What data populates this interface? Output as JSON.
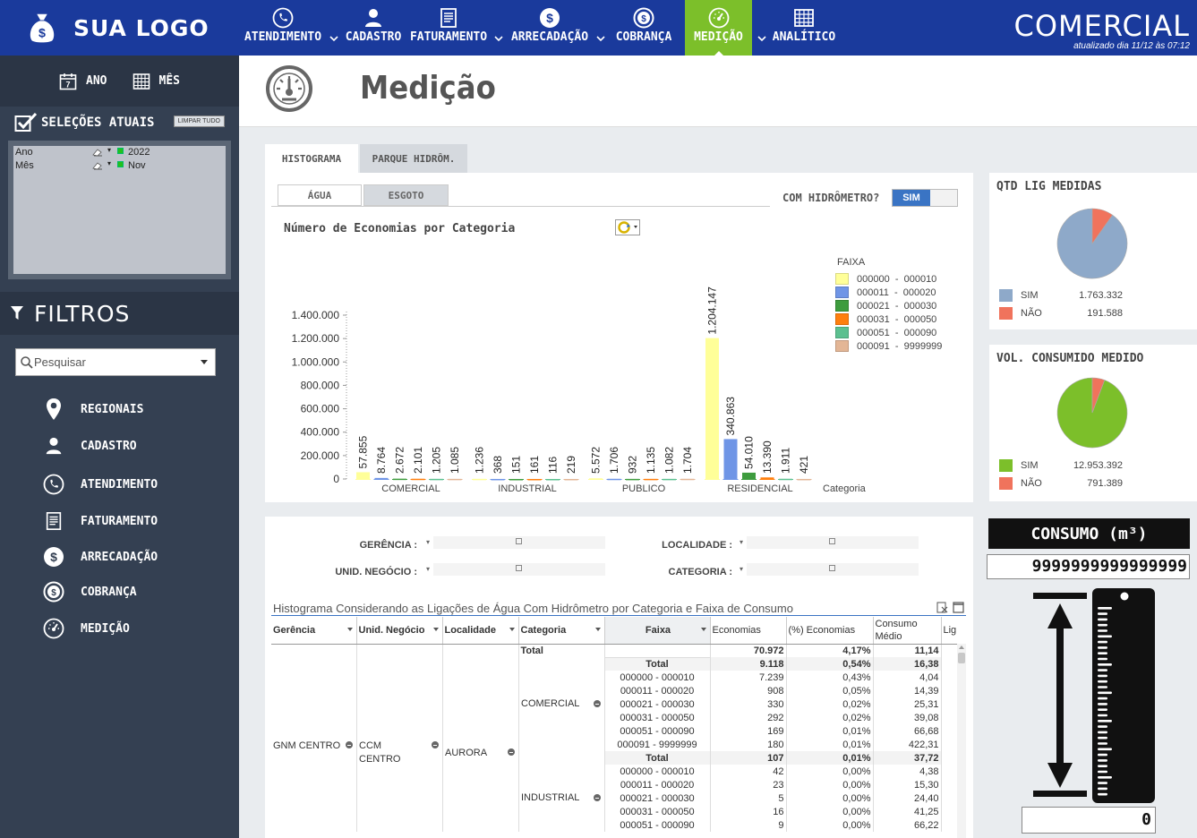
{
  "brand": {
    "logo_text": "SUA LOGO",
    "title": "COMERCIAL",
    "updated": "atualizado dia 11/12 às 07:12"
  },
  "nav": [
    {
      "label": "ATENDIMENTO",
      "icon": "phone-icon"
    },
    {
      "label": "CADASTRO",
      "icon": "user-icon"
    },
    {
      "label": "FATURAMENTO",
      "icon": "receipt-icon"
    },
    {
      "label": "ARRECADAÇÃO",
      "icon": "dollar-icon"
    },
    {
      "label": "COBRANÇA",
      "icon": "dollar-cycle-icon"
    },
    {
      "label": "MEDIÇÃO",
      "icon": "gauge-icon",
      "active": true
    },
    {
      "label": "ANALÍTICO",
      "icon": "grid-icon"
    }
  ],
  "sidebar": {
    "period": {
      "year": "ANO",
      "month": "MÊS"
    },
    "selections_title": "SELEÇÕES ATUAIS",
    "clear_all": "LIMPAR TUDO",
    "selections": [
      {
        "field": "Ano",
        "value": "2022"
      },
      {
        "field": "Mês",
        "value": "Nov"
      }
    ],
    "filters_title": "FILTROS",
    "search_placeholder": "Pesquisar",
    "menu": [
      "REGIONAIS",
      "CADASTRO",
      "ATENDIMENTO",
      "FATURAMENTO",
      "ARRECADAÇÃO",
      "COBRANÇA",
      "MEDIÇÃO"
    ]
  },
  "page": {
    "title": "Medição",
    "tabs": [
      "HISTOGRAMA",
      "PARQUE HIDRÔM."
    ],
    "subtabs": [
      "ÁGUA",
      "ESGOTO"
    ],
    "hidrometro_label": "COM HIDRÔMETRO?",
    "hidrometro_value": "SIM"
  },
  "chart_data": {
    "type": "bar",
    "title": "Número de Economias  por Categoria",
    "xlabel": "Categoria",
    "legend_title": "FAIXA",
    "ylim": [
      0,
      1400000
    ],
    "yticks": [
      "1.400.000",
      "1.200.000",
      "1.000.000",
      "800.000",
      "600.000",
      "400.000",
      "200.000",
      "0"
    ],
    "categories": [
      "COMERCIAL",
      "INDUSTRIAL",
      "PUBLICO",
      "RESIDENCIAL"
    ],
    "series": [
      {
        "name": "000000  -  000010",
        "color": "#ffff99",
        "values": [
          57855,
          1236,
          5572,
          1204147
        ],
        "labels": [
          "57.855",
          "1.236",
          "5.572",
          "1.204.147"
        ]
      },
      {
        "name": "000011  -  000020",
        "color": "#6f95e6",
        "values": [
          8764,
          368,
          1706,
          340863
        ],
        "labels": [
          "8.764",
          "368",
          "1.706",
          "340.863"
        ]
      },
      {
        "name": "000021  -  000030",
        "color": "#3e9c3e",
        "values": [
          2672,
          151,
          932,
          54010
        ],
        "labels": [
          "2.672",
          "151",
          "932",
          "54.010"
        ]
      },
      {
        "name": "000031  -  000050",
        "color": "#ff7f0e",
        "values": [
          2101,
          161,
          1135,
          13390
        ],
        "labels": [
          "2.101",
          "161",
          "1.135",
          "13.390"
        ]
      },
      {
        "name": "000051  -  000090",
        "color": "#5cc090",
        "values": [
          1205,
          116,
          1082,
          1911
        ],
        "labels": [
          "1.205",
          "116",
          "1.082",
          "1.911"
        ]
      },
      {
        "name": "000091  -  9999999",
        "color": "#e3b696",
        "values": [
          1085,
          219,
          1704,
          421
        ],
        "labels": [
          "1.085",
          "219",
          "1.704",
          "421"
        ]
      }
    ]
  },
  "cards": {
    "qtd": {
      "title": "QTD LIG MEDIDAS",
      "rows": [
        {
          "label": "SIM",
          "value": "1.763.332",
          "color": "#8ea9c9"
        },
        {
          "label": "NÃO",
          "value": "191.588",
          "color": "#f0735c"
        }
      ],
      "slices": [
        1763332,
        191588
      ]
    },
    "vol": {
      "title": "VOL. CONSUMIDO MEDIDO",
      "rows": [
        {
          "label": "SIM",
          "value": "12.953.392",
          "color": "#7cbf2a"
        },
        {
          "label": "NÃO",
          "value": "791.389",
          "color": "#f0735c"
        }
      ],
      "slices": [
        12953392,
        791389
      ]
    }
  },
  "consumo": {
    "title": "CONSUMO (m³)",
    "value": "9999999999999999",
    "zero": "0"
  },
  "filters": {
    "gerencia": "GERÊNCIA :",
    "localidade": "LOCALIDADE :",
    "unid": "UNID. NEGÓCIO :",
    "categoria": "CATEGORIA :"
  },
  "table": {
    "title": "Histograma Considerando as Ligações de Água Com Hidrômetro por Categoria e Faixa de Consumo",
    "headers": [
      "Gerência",
      "Unid. Negócio",
      "Localidade",
      "Categoria",
      "Faixa",
      "Economias",
      "(%) Economias",
      "Consumo Médio",
      "Lig"
    ],
    "gerencia": "GNM CENTRO",
    "unid": "CCM CENTRO",
    "localidade": "AURORA",
    "cat1": "COMERCIAL",
    "cat2": "INDUSTRIAL",
    "total_row": {
      "label": "Total",
      "economias": "70.972",
      "pct": "4,17%",
      "media": "11,14"
    },
    "rows": [
      {
        "faixa": "Total",
        "economias": "9.118",
        "pct": "0,54%",
        "media": "16,38",
        "bold": true
      },
      {
        "faixa": "000000 - 000010",
        "economias": "7.239",
        "pct": "0,43%",
        "media": "4,04"
      },
      {
        "faixa": "000011 - 000020",
        "economias": "908",
        "pct": "0,05%",
        "media": "14,39"
      },
      {
        "faixa": "000021 - 000030",
        "economias": "330",
        "pct": "0,02%",
        "media": "25,31"
      },
      {
        "faixa": "000031 - 000050",
        "economias": "292",
        "pct": "0,02%",
        "media": "39,08"
      },
      {
        "faixa": "000051 - 000090",
        "economias": "169",
        "pct": "0,01%",
        "media": "66,68"
      },
      {
        "faixa": "000091 - 9999999",
        "economias": "180",
        "pct": "0,01%",
        "media": "422,31"
      },
      {
        "faixa": "Total",
        "economias": "107",
        "pct": "0,01%",
        "media": "37,72",
        "bold": true
      },
      {
        "faixa": "000000 - 000010",
        "economias": "42",
        "pct": "0,00%",
        "media": "4,38"
      },
      {
        "faixa": "000011 - 000020",
        "economias": "23",
        "pct": "0,00%",
        "media": "15,30"
      },
      {
        "faixa": "000021 - 000030",
        "economias": "5",
        "pct": "0,00%",
        "media": "24,40"
      },
      {
        "faixa": "000031 - 000050",
        "economias": "16",
        "pct": "0,00%",
        "media": "41,25"
      },
      {
        "faixa": "000051 - 000090",
        "economias": "9",
        "pct": "0,00%",
        "media": "66,22"
      }
    ]
  }
}
